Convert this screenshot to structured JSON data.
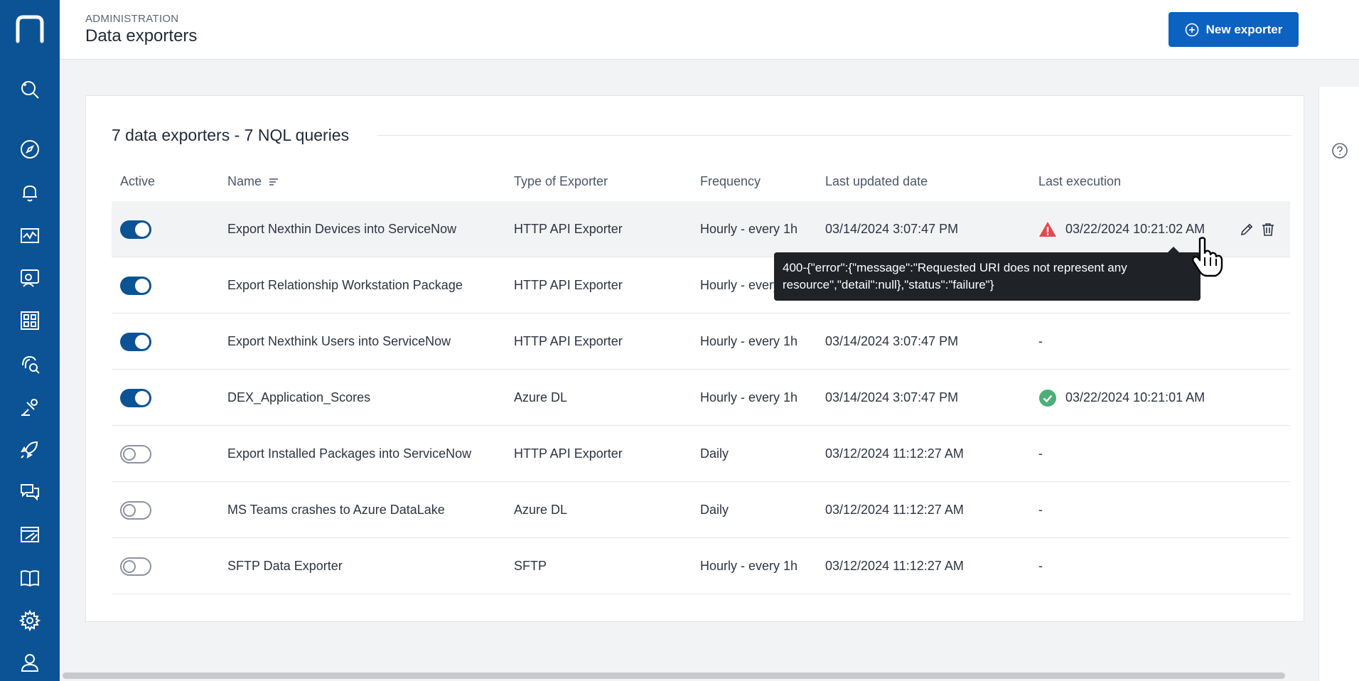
{
  "header": {
    "breadcrumb": "ADMINISTRATION",
    "title": "Data exporters",
    "new_button_label": "New exporter"
  },
  "sidebar": {
    "items": [
      "logo-icon",
      "search-ai-icon",
      "compass-icon",
      "bell-icon",
      "chart-icon",
      "people-icon",
      "dashboard-icon",
      "fingerprint-search-icon",
      "remote-action-icon",
      "rocket-icon",
      "chat-icon",
      "design-icon",
      "book-icon",
      "gear-icon",
      "user-icon"
    ]
  },
  "card": {
    "title": "7 data exporters - 7 NQL queries"
  },
  "table": {
    "columns": {
      "active": "Active",
      "name": "Name",
      "type": "Type of Exporter",
      "frequency": "Frequency",
      "updated": "Last updated date",
      "execution": "Last execution"
    },
    "rows": [
      {
        "active": true,
        "name": "Export Nexthin Devices into ServiceNow",
        "type": "HTTP API Exporter",
        "frequency": "Hourly - every 1h",
        "updated": "03/14/2024 3:07:47 PM",
        "execution": "03/22/2024 10:21:02 AM",
        "status": "error"
      },
      {
        "active": true,
        "name": "Export Relationship Workstation Package",
        "type": "HTTP API Exporter",
        "frequency": "Hourly - every 1h",
        "updated": "",
        "execution": "",
        "status": "none"
      },
      {
        "active": true,
        "name": "Export Nexthink Users into ServiceNow",
        "type": "HTTP API Exporter",
        "frequency": "Hourly - every 1h",
        "updated": "03/14/2024 3:07:47 PM",
        "execution": "-",
        "status": "none"
      },
      {
        "active": true,
        "name": "DEX_Application_Scores",
        "type": "Azure DL",
        "frequency": "Hourly - every 1h",
        "updated": "03/14/2024 3:07:47 PM",
        "execution": "03/22/2024 10:21:01 AM",
        "status": "success"
      },
      {
        "active": false,
        "name": "Export Installed Packages into ServiceNow",
        "type": "HTTP API Exporter",
        "frequency": "Daily",
        "updated": "03/12/2024 11:12:27 AM",
        "execution": "-",
        "status": "none"
      },
      {
        "active": false,
        "name": "MS Teams crashes to Azure DataLake",
        "type": "Azure DL",
        "frequency": "Daily",
        "updated": "03/12/2024 11:12:27 AM",
        "execution": "-",
        "status": "none"
      },
      {
        "active": false,
        "name": "SFTP Data Exporter",
        "type": "SFTP",
        "frequency": "Hourly - every 1h",
        "updated": "03/12/2024 11:12:27 AM",
        "execution": "-",
        "status": "none"
      }
    ]
  },
  "tooltip": {
    "line1": "400-{\"error\":{\"message\":\"Requested URI does not represent any",
    "line2": "resource\",\"detail\":null},\"status\":\"failure\"}"
  },
  "colors": {
    "sidebar": "#0b5394",
    "primary": "#0c62c1",
    "error": "#e5484d",
    "success": "#4caf7a"
  }
}
